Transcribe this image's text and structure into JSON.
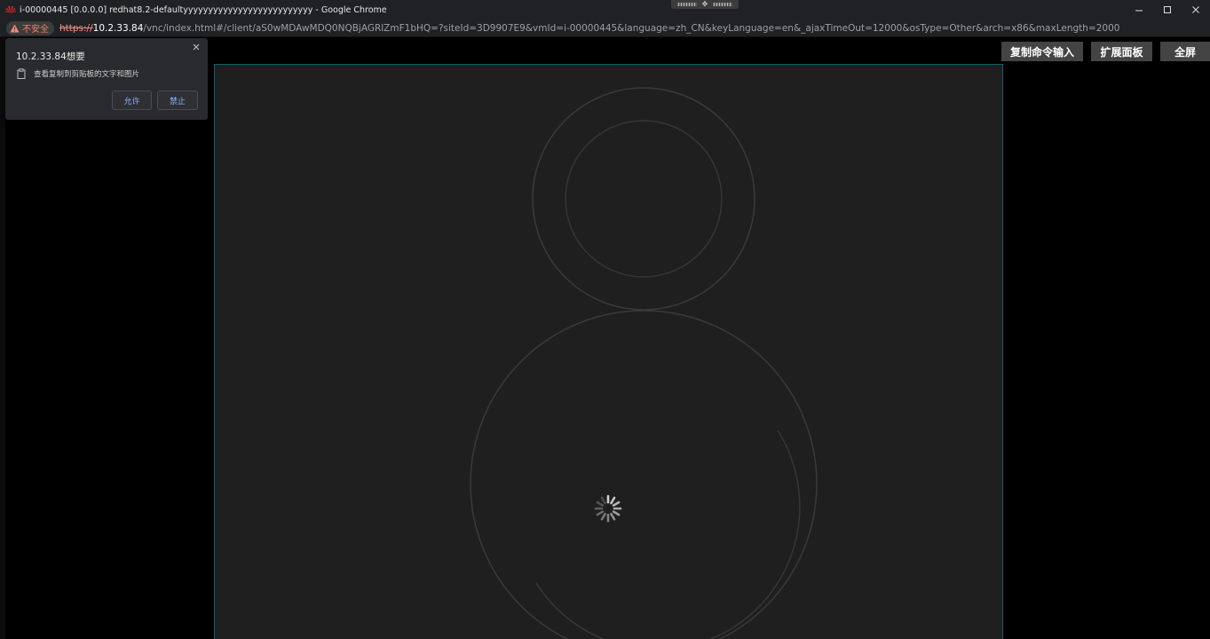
{
  "window": {
    "title": "i-00000445 [0.0.0.0] redhat8.2-defaultyyyyyyyyyyyyyyyyyyyyyyyyyy - Google Chrome",
    "drag_handle_glyph": "✥"
  },
  "address_bar": {
    "security_label": "不安全",
    "url_scheme": "https://",
    "url_host": "10.2.33.84",
    "url_path": "/vnc/index.html#/client/aS0wMDAwMDQ0NQBjAGRlZmF1bHQ=?siteId=3D9907E9&vmId=i-00000445&language=zh_CN&keyLanguage=en&_ajaxTimeOut=12000&osType=Other&arch=x86&maxLength=2000"
  },
  "toolbar": {
    "copy_command_input": "复制命令输入",
    "extended_panel": "扩展面板",
    "fullscreen": "全屏"
  },
  "permission_popup": {
    "title": "10.2.33.84想要",
    "description": "查看复制到剪贴板的文字和图片",
    "allow_label": "允许",
    "block_label": "禁止"
  },
  "icons": {
    "app": "huawei-logo-icon",
    "warning": "warning-triangle-icon",
    "clipboard": "clipboard-icon",
    "close": "close-icon",
    "spinner": "loading-spinner-icon"
  },
  "colors": {
    "insecure": "#f28b82",
    "button_bg": "#444444",
    "canvas_bg": "#1f1f1f",
    "canvas_border": "#10606e",
    "link_blue": "#8ab4f8"
  }
}
